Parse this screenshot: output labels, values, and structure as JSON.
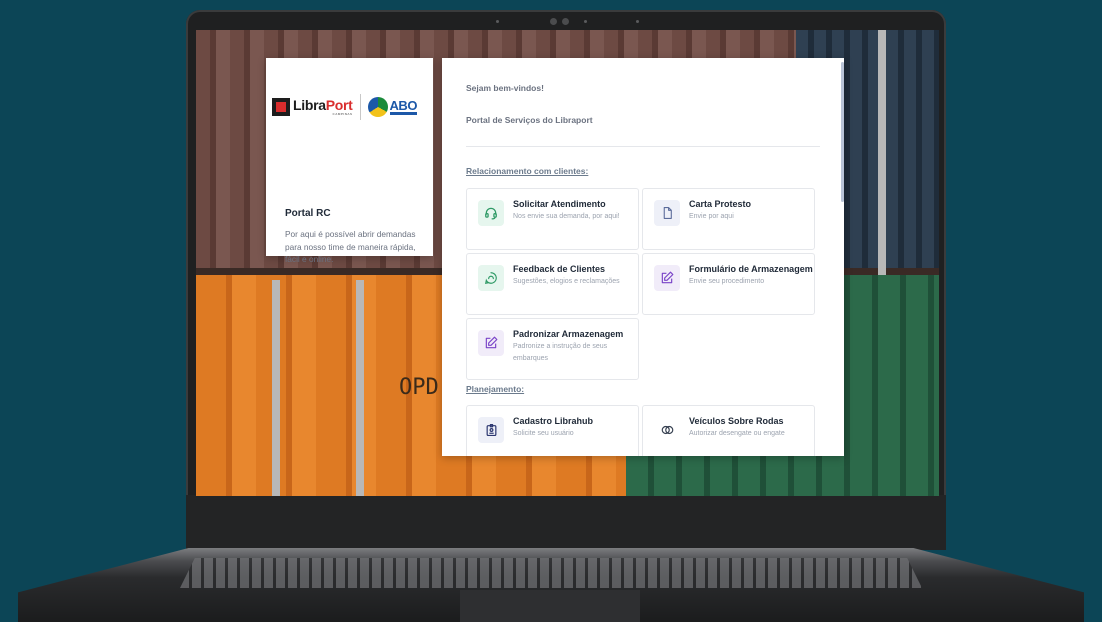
{
  "brand": {
    "libra": "Libra",
    "port": "Port",
    "campinas": "CAMPINAS",
    "abo": "ABO"
  },
  "left_card": {
    "title": "Portal RC",
    "description": "Por aqui é possível abrir demandas para nosso time de maneira rápida, fácil e online."
  },
  "right_panel": {
    "welcome": "Sejam bem-vindos!",
    "subtitle": "Portal de Serviços do Libraport",
    "sections": [
      {
        "title": "Relacionamento com clientes:",
        "tiles": [
          {
            "title": "Solicitar Atendimento",
            "desc": "Nos envie sua demanda, por aqui!",
            "icon": "headset-icon",
            "color": "green"
          },
          {
            "title": "Carta Protesto",
            "desc": "Envie por aqui",
            "icon": "document-icon",
            "color": "blue"
          },
          {
            "title": "Feedback de Clientes",
            "desc": "Sugestões, elogios e reclamações",
            "icon": "feedback-icon",
            "color": "green"
          },
          {
            "title": "Formulário de Armazenagem",
            "desc": "Envie seu procedimento",
            "icon": "edit-icon",
            "color": "purple"
          },
          {
            "title": "Padronizar Armazenagem",
            "desc": "Padronize a instrução de seus embarques",
            "icon": "edit-icon",
            "color": "purple"
          }
        ]
      },
      {
        "title": "Planejamento:",
        "tiles": [
          {
            "title": "Cadastro Librahub",
            "desc": "Solicite seu usuário",
            "icon": "id-badge-icon",
            "color": "navy"
          },
          {
            "title": "Veículos Sobre Rodas",
            "desc": "Autorizar desengate ou engate",
            "icon": "toggle-icon",
            "color": "plain"
          }
        ]
      }
    ]
  },
  "background": {
    "container_text": "OPD"
  }
}
